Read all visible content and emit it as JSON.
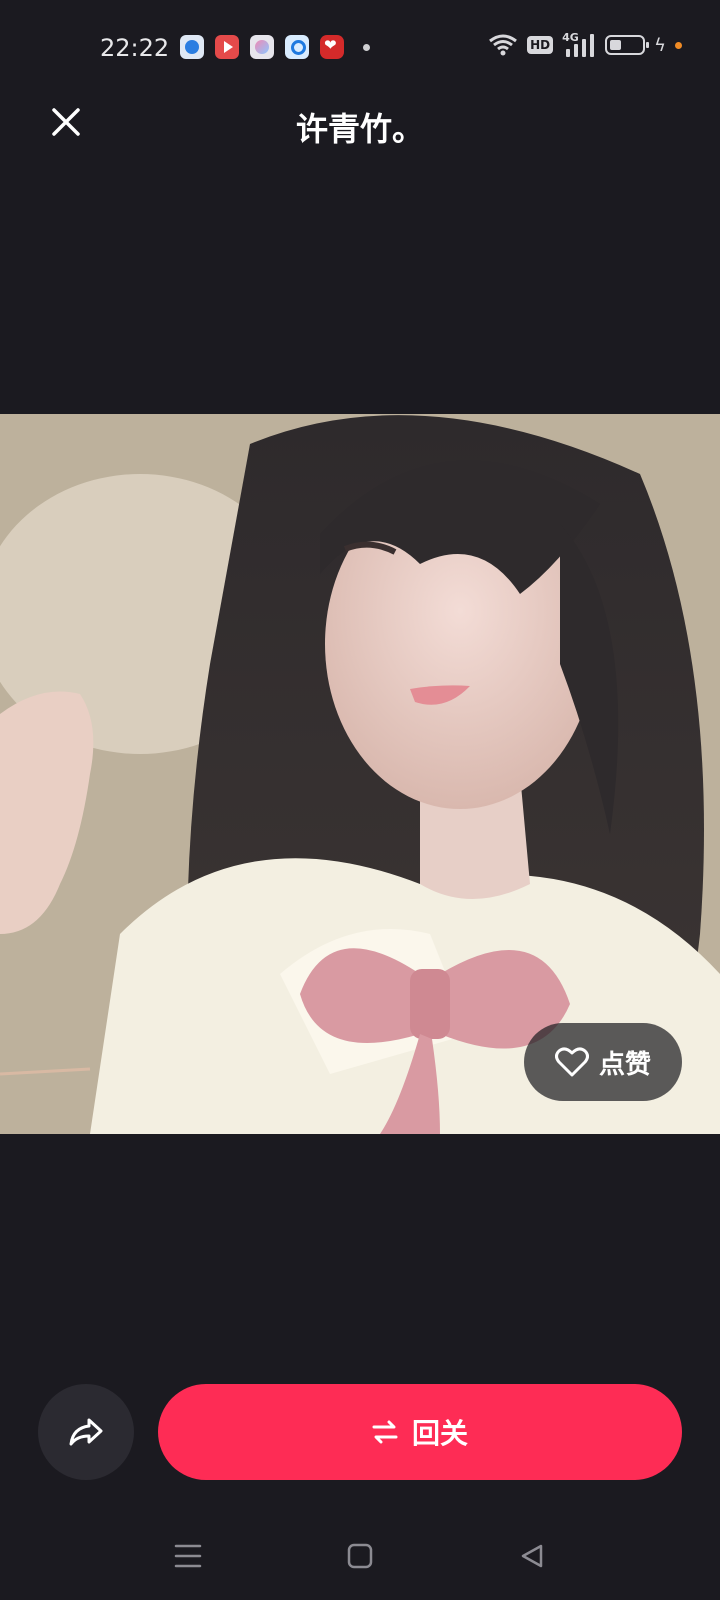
{
  "status_bar": {
    "time": "22:22",
    "notification_icons": [
      "browser-icon",
      "video-icon",
      "gallery-icon",
      "search-icon",
      "shop-icon"
    ],
    "network": "4G",
    "hd": "HD",
    "battery_level": 0.35
  },
  "header": {
    "title": "许青竹。",
    "close_icon": "close-icon"
  },
  "photo": {
    "like_label": "点赞",
    "like_icon": "heart-outline-icon"
  },
  "actions": {
    "share_icon": "share-arrow-icon",
    "follow_label": "回关",
    "follow_icon": "mutual-arrows-icon",
    "follow_color": "#fe2c55"
  },
  "nav_bar": {
    "menu_icon": "menu-icon",
    "home_icon": "home-square-icon",
    "back_icon": "back-triangle-icon"
  }
}
